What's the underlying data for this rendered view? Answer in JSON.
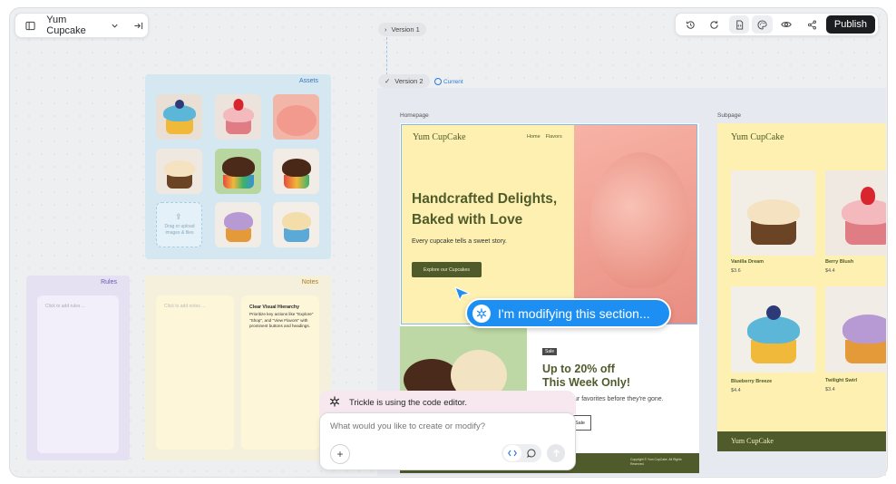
{
  "toolbar_left": {
    "project_name": "Yum Cupcake"
  },
  "toolbar_right": {
    "publish_label": "Publish"
  },
  "versions": {
    "v1_label": "Version 1",
    "v2_label": "Version 2",
    "current_label": "Current"
  },
  "assets": {
    "title": "Assets",
    "upload_text": "Drag or upload images & files"
  },
  "rules": {
    "title": "Rules",
    "placeholder": "Click to add rules ..."
  },
  "notes": {
    "title": "Notes",
    "placeholder": "Click to add notes ...",
    "note_title": "Clear Visual Hierarchy",
    "note_body": "Prioritize key actions like \"Explore\" \"Shop\", and \"View Flavors\" with prominent buttons and headings."
  },
  "homepage": {
    "label": "Homepage",
    "brand": "Yum CupCake",
    "nav": [
      "Home",
      "Flavors"
    ],
    "headline_1": "Handcrafted Delights,",
    "headline_2": "Baked with Love",
    "subtext": "Every cupcake tells a sweet story.",
    "cta": "Explore our Cupcakes",
    "sale_tag": "Sale",
    "promo_1": "Up to 20% off",
    "promo_2": "This Week Only!",
    "promo_sub": "Save on your favorites before they're gone.",
    "promo_btn": "Sale",
    "footer_text": "Copyright © Yum CupCake. All Rights Reserved."
  },
  "subpage": {
    "label": "Subpage",
    "brand": "Yum CupCake",
    "footer_brand": "Yum CupCake",
    "products": [
      {
        "name": "Vanilla Dream",
        "price": "$3.6"
      },
      {
        "name": "Berry Blush",
        "price": "$4.4"
      },
      {
        "name": "Blueberry Breeze",
        "price": "$4.4"
      },
      {
        "name": "Twilight Swirl",
        "price": "$3.4"
      }
    ]
  },
  "modify_tip": "I'm modifying this section...",
  "chat": {
    "status": "Trickle is using the code editor.",
    "placeholder": "What would you like to create or modify?"
  },
  "colors": {
    "accent": "#1d8ff2",
    "olive": "#4f5b2b",
    "cream": "#fdf0b0"
  }
}
